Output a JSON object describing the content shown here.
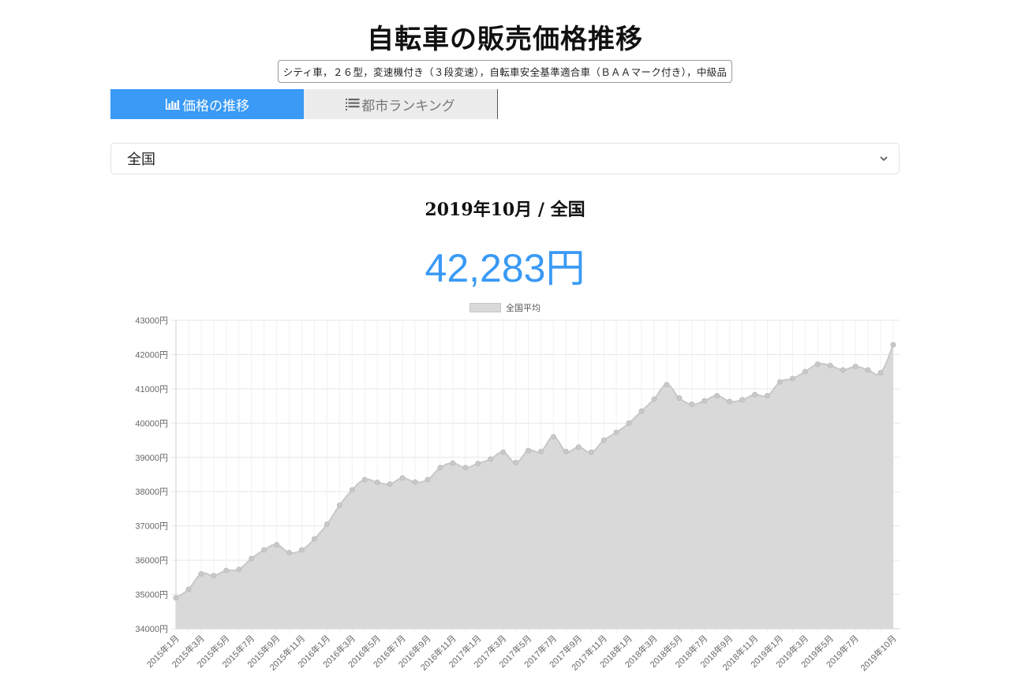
{
  "header": {
    "title": "自転車の販売価格推移",
    "subtitle": "シティ車，２６型，変速機付き（３段変速），自転車安全基準適合車（ＢＡＡマーク付き），中級品"
  },
  "tabs": [
    {
      "label": "価格の推移",
      "icon": "bar-chart-icon",
      "active": true
    },
    {
      "label": "都市ランキング",
      "icon": "list-icon",
      "active": false
    }
  ],
  "region_select": {
    "value": "全国",
    "icon": "chevron-down-icon"
  },
  "summary": {
    "period": "2019年10月 / 全国",
    "price": "42,283円"
  },
  "colors": {
    "accent": "#3a9af5",
    "series_fill": "#d9d9d9",
    "series_line": "#c8c8c8"
  },
  "chart_data": {
    "type": "area",
    "series": [
      {
        "name": "全国平均",
        "values": [
          34900,
          35150,
          35600,
          35550,
          35700,
          35730,
          36050,
          36300,
          36450,
          36220,
          36300,
          36620,
          37050,
          37600,
          38050,
          38350,
          38270,
          38220,
          38400,
          38280,
          38350,
          38700,
          38830,
          38700,
          38820,
          38950,
          39150,
          38850,
          39200,
          39170,
          39600,
          39170,
          39300,
          39150,
          39500,
          39730,
          40000,
          40350,
          40700,
          41120,
          40730,
          40550,
          40650,
          40800,
          40630,
          40680,
          40830,
          40800,
          41200,
          41300,
          41500,
          41720,
          41680,
          41550,
          41650,
          41550,
          41470,
          42283
        ]
      }
    ],
    "x": [
      "2015年1月",
      "2015年2月",
      "2015年3月",
      "2015年4月",
      "2015年5月",
      "2015年6月",
      "2015年7月",
      "2015年8月",
      "2015年9月",
      "2015年10月",
      "2015年11月",
      "2015年12月",
      "2016年1月",
      "2016年2月",
      "2016年3月",
      "2016年4月",
      "2016年5月",
      "2016年6月",
      "2016年7月",
      "2016年8月",
      "2016年9月",
      "2016年10月",
      "2016年11月",
      "2016年12月",
      "2017年1月",
      "2017年2月",
      "2017年3月",
      "2017年4月",
      "2017年5月",
      "2017年6月",
      "2017年7月",
      "2017年8月",
      "2017年9月",
      "2017年10月",
      "2017年11月",
      "2017年12月",
      "2018年1月",
      "2018年2月",
      "2018年3月",
      "2018年4月",
      "2018年5月",
      "2018年6月",
      "2018年7月",
      "2018年8月",
      "2018年9月",
      "2018年10月",
      "2018年11月",
      "2018年12月",
      "2019年1月",
      "2019年2月",
      "2019年3月",
      "2019年4月",
      "2019年5月",
      "2019年6月",
      "2019年7月",
      "2019年8月",
      "2019年9月",
      "2019年10月"
    ],
    "x_tick_labels": [
      "2015年1月",
      "2015年3月",
      "2015年5月",
      "2015年7月",
      "2015年9月",
      "2015年11月",
      "2016年1月",
      "2016年3月",
      "2016年5月",
      "2016年7月",
      "2016年9月",
      "2016年11月",
      "2017年1月",
      "2017年3月",
      "2017年5月",
      "2017年7月",
      "2017年9月",
      "2017年11月",
      "2018年1月",
      "2018年3月",
      "2018年5月",
      "2018年7月",
      "2018年9月",
      "2018年11月",
      "2019年1月",
      "2019年3月",
      "2019年5月",
      "2019年7月",
      "2019年10月"
    ],
    "y_tick_labels": [
      "34000円",
      "35000円",
      "36000円",
      "37000円",
      "38000円",
      "39000円",
      "40000円",
      "41000円",
      "42000円",
      "43000円"
    ],
    "ylim": [
      34000,
      43000
    ],
    "grid": true,
    "legend": "top-center",
    "title": "",
    "xlabel": "",
    "ylabel": ""
  }
}
